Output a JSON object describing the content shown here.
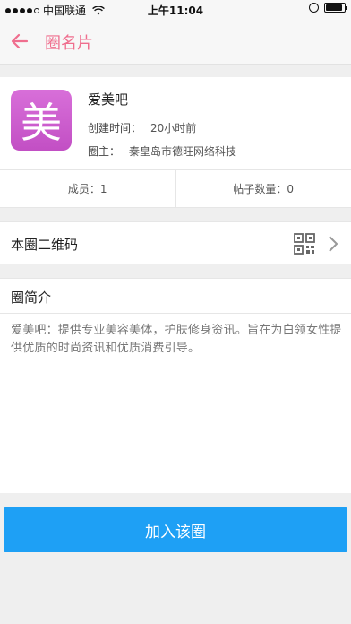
{
  "status_bar": {
    "carrier": "中国联通",
    "time": "上午11:04",
    "signal_bars": 4,
    "battery_level": 0.9
  },
  "navbar": {
    "back_icon": "back-arrow-icon",
    "title": "圈名片",
    "accent_color": "#ef6e8e"
  },
  "profile": {
    "avatar_char": "美",
    "avatar_color": "#c24fc4",
    "name": "爱美吧",
    "created_label": "创建时间：",
    "created_value": "20小时前",
    "owner_label": "圈主：",
    "owner_value": "秦皇岛市德旺网络科技"
  },
  "stats": {
    "members": "成员：1",
    "posts": "帖子数量：0"
  },
  "qr_row": {
    "label": "本圈二维码",
    "icon": "qr-code-icon",
    "chevron": "chevron-right-icon"
  },
  "intro": {
    "title": "圈简介",
    "text": "爱美吧：提供专业美容美体，护肤修身资讯。旨在为白领女性提供优质的时尚资讯和优质消费引导。"
  },
  "join_button": {
    "label": "加入该圈",
    "color": "#1ea0f5"
  }
}
